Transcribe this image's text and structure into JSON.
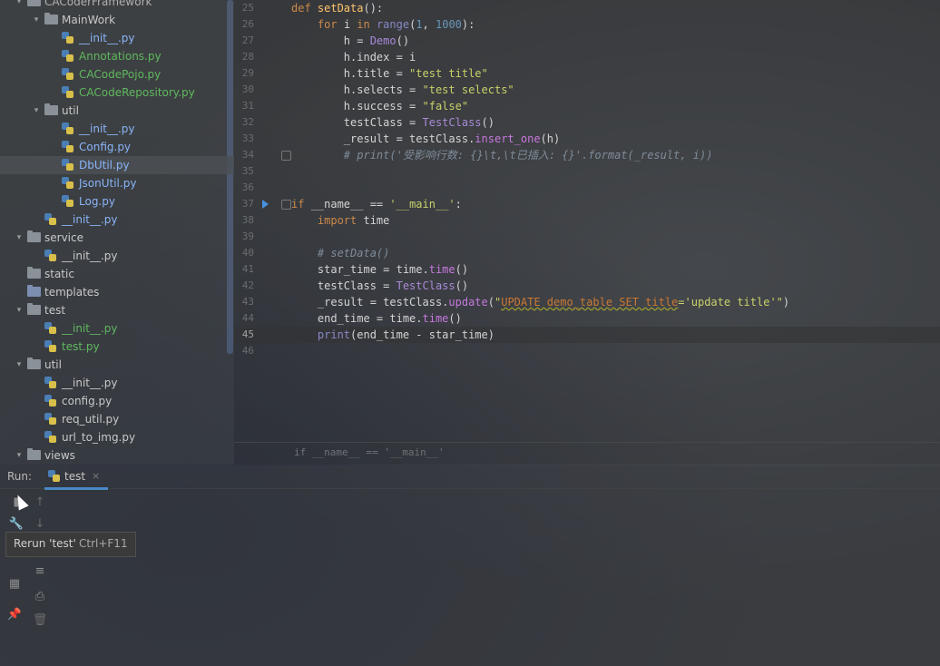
{
  "tree": {
    "rows": [
      {
        "label": "CACoderFramework",
        "type": "folder",
        "indent": 1,
        "expanded": true,
        "color": "dim"
      },
      {
        "label": "MainWork",
        "type": "folder",
        "indent": 2,
        "expanded": true,
        "color": "normal"
      },
      {
        "label": "__init__.py",
        "type": "py",
        "indent": 3,
        "color": "blue"
      },
      {
        "label": "Annotations.py",
        "type": "py",
        "indent": 3,
        "color": "green"
      },
      {
        "label": "CACodePojo.py",
        "type": "py",
        "indent": 3,
        "color": "green"
      },
      {
        "label": "CACodeRepository.py",
        "type": "py",
        "indent": 3,
        "color": "green"
      },
      {
        "label": "util",
        "type": "folder",
        "indent": 2,
        "expanded": true,
        "color": "normal"
      },
      {
        "label": "__init__.py",
        "type": "py",
        "indent": 3,
        "color": "blue"
      },
      {
        "label": "Config.py",
        "type": "py",
        "indent": 3,
        "color": "blue"
      },
      {
        "label": "DbUtil.py",
        "type": "py",
        "indent": 3,
        "color": "blue",
        "selected": true
      },
      {
        "label": "JsonUtil.py",
        "type": "py",
        "indent": 3,
        "color": "blue"
      },
      {
        "label": "Log.py",
        "type": "py",
        "indent": 3,
        "color": "blue"
      },
      {
        "label": "__init__.py",
        "type": "py",
        "indent": 2,
        "color": "blue"
      },
      {
        "label": "service",
        "type": "folder",
        "indent": 1,
        "expanded": true,
        "color": "normal"
      },
      {
        "label": "__init__.py",
        "type": "py",
        "indent": 2,
        "color": "normal"
      },
      {
        "label": "static",
        "type": "folder",
        "indent": 1,
        "expanded": false,
        "color": "normal",
        "noarrow": true
      },
      {
        "label": "templates",
        "type": "folder",
        "indent": 1,
        "expanded": false,
        "color": "normal",
        "noarrow": true,
        "blue": true
      },
      {
        "label": "test",
        "type": "folder",
        "indent": 1,
        "expanded": true,
        "color": "normal"
      },
      {
        "label": "__init__.py",
        "type": "py",
        "indent": 2,
        "color": "green"
      },
      {
        "label": "test.py",
        "type": "py",
        "indent": 2,
        "color": "green"
      },
      {
        "label": "util",
        "type": "folder",
        "indent": 1,
        "expanded": true,
        "color": "normal"
      },
      {
        "label": "__init__.py",
        "type": "py",
        "indent": 2,
        "color": "normal"
      },
      {
        "label": "config.py",
        "type": "py",
        "indent": 2,
        "color": "normal"
      },
      {
        "label": "req_util.py",
        "type": "py",
        "indent": 2,
        "color": "normal"
      },
      {
        "label": "url_to_img.py",
        "type": "py",
        "indent": 2,
        "color": "normal"
      },
      {
        "label": "views",
        "type": "folder",
        "indent": 1,
        "expanded": true,
        "color": "normal"
      }
    ]
  },
  "editor": {
    "line_numbers": [
      "25",
      "26",
      "27",
      "28",
      "29",
      "30",
      "31",
      "32",
      "33",
      "34",
      "35",
      "36",
      "37",
      "38",
      "39",
      "40",
      "41",
      "42",
      "43",
      "44",
      "45",
      "46"
    ],
    "current_line": "45",
    "breadcrumb": "if __name__ == '__main__'"
  },
  "run": {
    "label": "Run:",
    "tab_label": "test",
    "tooltip_text": "Rerun 'test'",
    "tooltip_shortcut": "Ctrl+F11"
  },
  "colors": {
    "accent": "#4a88c7",
    "green_file": "#5fb85f",
    "blue_file": "#8ab4f8"
  }
}
